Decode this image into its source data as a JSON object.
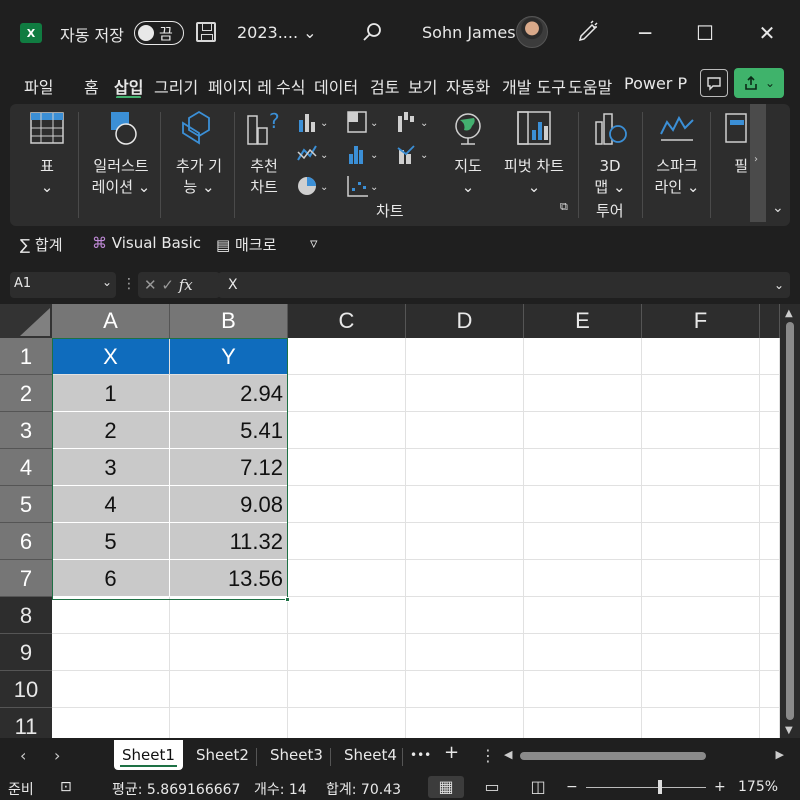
{
  "title_bar": {
    "app_logo": "X",
    "autosave_label": "자동 저장",
    "autosave_state": "끔",
    "filename": "2023.... ⌄",
    "user_name": "Sohn James",
    "minimize": "─",
    "maximize": "☐",
    "close": "✕"
  },
  "menu": {
    "tabs": [
      "파일",
      "홈",
      "삽입",
      "그리기",
      "페이지 레",
      "수식",
      "데이터",
      "검토",
      "보기",
      "자동화",
      "개발 도구",
      "도움말",
      "Power P"
    ],
    "active_index": 2
  },
  "ribbon": {
    "table": "표",
    "illustrations_1": "일러스트",
    "illustrations_2": "레이션 ⌄",
    "addins_1": "추가 기",
    "addins_2": "능 ⌄",
    "recommended_1": "추천",
    "recommended_2": "차트",
    "charts_group": "차트",
    "maps_label": "지도",
    "pivot_chart": "피벗 차트",
    "map3d_1": "3D",
    "map3d_2": "맵 ⌄",
    "tours_group": "투어",
    "sparklines_1": "스파크",
    "sparklines_2": "라인 ⌄",
    "filter_partial": "필"
  },
  "quick_access": {
    "sum": "합계",
    "visual_basic": "Visual Basic",
    "macros": "매크로",
    "more": "▿"
  },
  "formula_bar": {
    "name_box": "A1",
    "fx": "fx",
    "content": "X"
  },
  "grid": {
    "columns": [
      "A",
      "B",
      "C",
      "D",
      "E",
      "F"
    ],
    "rows": [
      "1",
      "2",
      "3",
      "4",
      "5",
      "6",
      "7",
      "8",
      "9",
      "10",
      "11"
    ],
    "header": [
      "X",
      "Y"
    ],
    "data": [
      [
        "1",
        "2.94"
      ],
      [
        "2",
        "5.41"
      ],
      [
        "3",
        "7.12"
      ],
      [
        "4",
        "9.08"
      ],
      [
        "5",
        "11.32"
      ],
      [
        "6",
        "13.56"
      ]
    ]
  },
  "sheets": {
    "tabs": [
      "Sheet1",
      "Sheet2",
      "Sheet3",
      "Sheet4"
    ],
    "active_index": 0,
    "more": "•••",
    "add": "+"
  },
  "status": {
    "ready": "준비",
    "average": "평균: 5.869166667",
    "count": "개수: 14",
    "sum": "합계: 70.43",
    "zoom": "175%"
  },
  "colors": {
    "accent_green": "#3fb36b",
    "header_blue": "#0f6cbd",
    "data_gray": "#c9c9c9"
  }
}
